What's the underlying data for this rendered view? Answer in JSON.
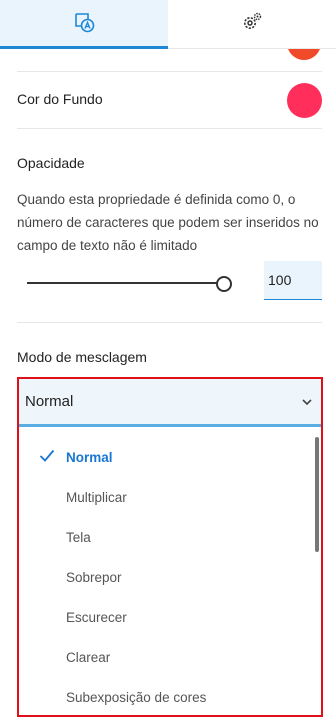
{
  "tabs": [
    {
      "icon": "style-format-icon",
      "active": true
    },
    {
      "icon": "gear-icon",
      "active": false
    }
  ],
  "colors": {
    "accent": "#1e88d6",
    "previous_color_swatch": "#f04a2a",
    "background_color_swatch": "#ff2e5b",
    "highlight_frame": "#e0101a"
  },
  "background_color": {
    "label": "Cor do Fundo"
  },
  "opacity": {
    "title": "Opacidade",
    "description": "Quando esta propriedade é definida como 0, o número de caracteres que podem ser inseridos no campo de texto não é limitado",
    "value": "100",
    "slider_fraction": 1.0
  },
  "blend_mode": {
    "title": "Modo de mesclagem",
    "selected": "Normal",
    "options": [
      "Normal",
      "Multiplicar",
      "Tela",
      "Sobrepor",
      "Escurecer",
      "Clarear",
      "Subexposição de cores"
    ]
  }
}
